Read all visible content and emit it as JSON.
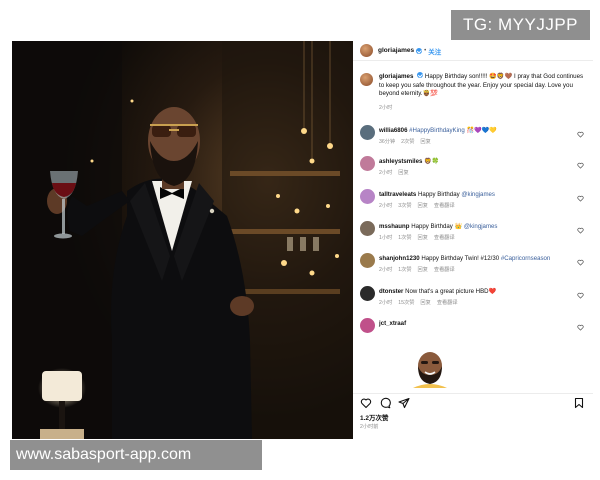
{
  "watermarks": {
    "telegram": "TG: MYYJJPP",
    "website": "www.sabasport-app.com"
  },
  "post": {
    "username": "gloriajames",
    "follow_label": "关注",
    "caption": {
      "username": "gloriajames",
      "text": "Happy Birthday son!!!!! 🤩🦁🤎 I pray that God continues to keep you safe throughout the year. Enjoy your special day. Love you beyond eternity.🤴🏾💯",
      "time": "2小时"
    },
    "comments": [
      {
        "user": "willia6806",
        "text": "",
        "link": "#HappyBirthdayKing",
        "emoji": "🎊💜💙💛",
        "time": "36分钟",
        "likes": "2次赞",
        "reply": "回复",
        "view_replies": "",
        "avatar_color": "#5a6e7d"
      },
      {
        "user": "ashleystsmiles",
        "text": "",
        "link": "",
        "emoji": "🦁🍀",
        "time": "2小时",
        "likes": "",
        "reply": "回复",
        "view_replies": "",
        "avatar_color": "#c07a9a"
      },
      {
        "user": "talltraveleats",
        "text": "Happy Birthday",
        "link": "@kingjames",
        "emoji": "",
        "time": "2小时",
        "likes": "3次赞",
        "reply": "回复",
        "view_replies": "查看翻译",
        "avatar_color": "#b784c6"
      },
      {
        "user": "msshaunp",
        "text": "Happy Birthday 👑",
        "link": "@kingjames",
        "emoji": "",
        "time": "1小时",
        "likes": "1次赞",
        "reply": "回复",
        "view_replies": "查看翻译",
        "avatar_color": "#7a6a5a"
      },
      {
        "user": "shanjohn1230",
        "text": "Happy Birthday Twin! #12/30",
        "link": "#Capricornseason",
        "emoji": "",
        "time": "2小时",
        "likes": "1次赞",
        "reply": "回复",
        "view_replies": "查看翻译",
        "avatar_color": "#9a7a4c"
      },
      {
        "user": "dtonster",
        "text": "Now that's a great picture HBD❤️",
        "link": "",
        "emoji": "",
        "time": "2小时",
        "likes": "15次赞",
        "reply": "回复",
        "view_replies": "查看翻译",
        "avatar_color": "#2a2a2a"
      },
      {
        "user": "jct_xtraaf",
        "text": "",
        "link": "",
        "emoji": "",
        "time": "",
        "likes": "",
        "reply": "",
        "view_replies": "",
        "avatar_color": "#c0508a"
      }
    ],
    "likes": "1.2万次赞",
    "time": "2小时前",
    "icons": {
      "like": "heart-icon",
      "comment": "comment-icon",
      "share": "share-icon",
      "save": "bookmark-icon"
    }
  }
}
